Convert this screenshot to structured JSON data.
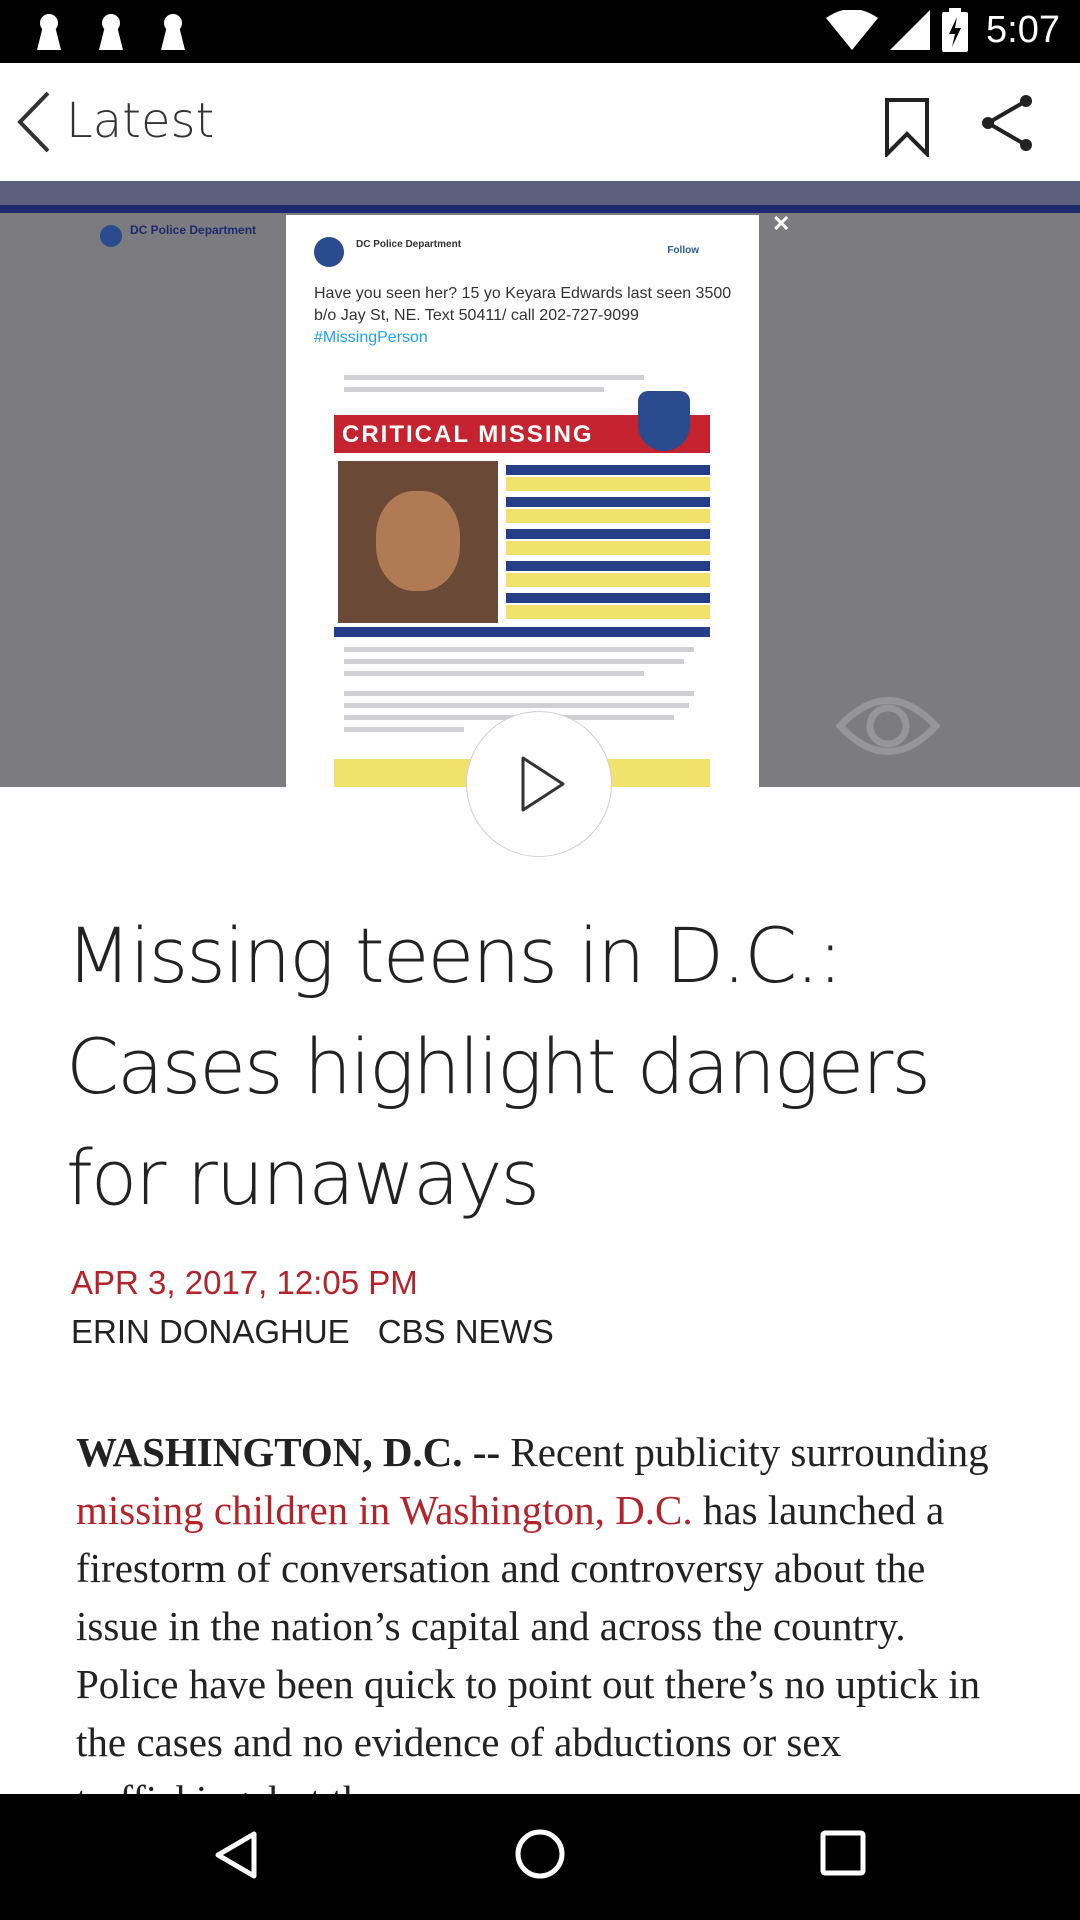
{
  "status_bar": {
    "time": "5:07",
    "notification_icons": [
      "pin-icon",
      "pin-icon",
      "pin-icon"
    ],
    "system_icons": [
      "wifi-icon",
      "signal-icon",
      "battery-charging-icon"
    ]
  },
  "app_bar": {
    "back_label": "Latest",
    "actions": [
      "bookmark-icon",
      "share-icon"
    ]
  },
  "video": {
    "tweet_account": "DC Police Department",
    "tweet_follow": "Follow",
    "tweet_text": "Have you seen her? 15 yo Keyara Edwards last seen 3500 b/o Jay St, NE. Text 50411/ call 202-727-9099",
    "tweet_hashtag": "#MissingPerson",
    "flyer_title": "CRITICAL MISSING",
    "bg_account": "DC Police Department",
    "play_icon": "play-icon",
    "watermark_icon": "cbs-eye-icon"
  },
  "article": {
    "headline": "Missing teens in D.C.: Cases highlight dangers for runaways",
    "date": "APR 3, 2017, 12:05 PM",
    "author": "ERIN DONAGHUE",
    "source": "CBS NEWS",
    "dateline": "WASHINGTON, D.C. --",
    "body_intro": "Recent publicity surrounding",
    "body_link": "missing children in Washington, D.C.",
    "body_rest": "has launched a firestorm of conversation and controversy about the issue in the nation’s capital and across the country. Police have been quick to point out there’s no uptick in the cases and no evidence of abductions or sex trafficking, but the"
  },
  "nav_bar": {
    "buttons": [
      "back-triangle-icon",
      "home-circle-icon",
      "recents-square-icon"
    ]
  },
  "colors": {
    "accent_red": "#b32329",
    "hero_gray": "#7c7c80",
    "flyer_red": "#c4232f",
    "flyer_navy": "#263e86",
    "flyer_yellow": "#f1e26e"
  }
}
